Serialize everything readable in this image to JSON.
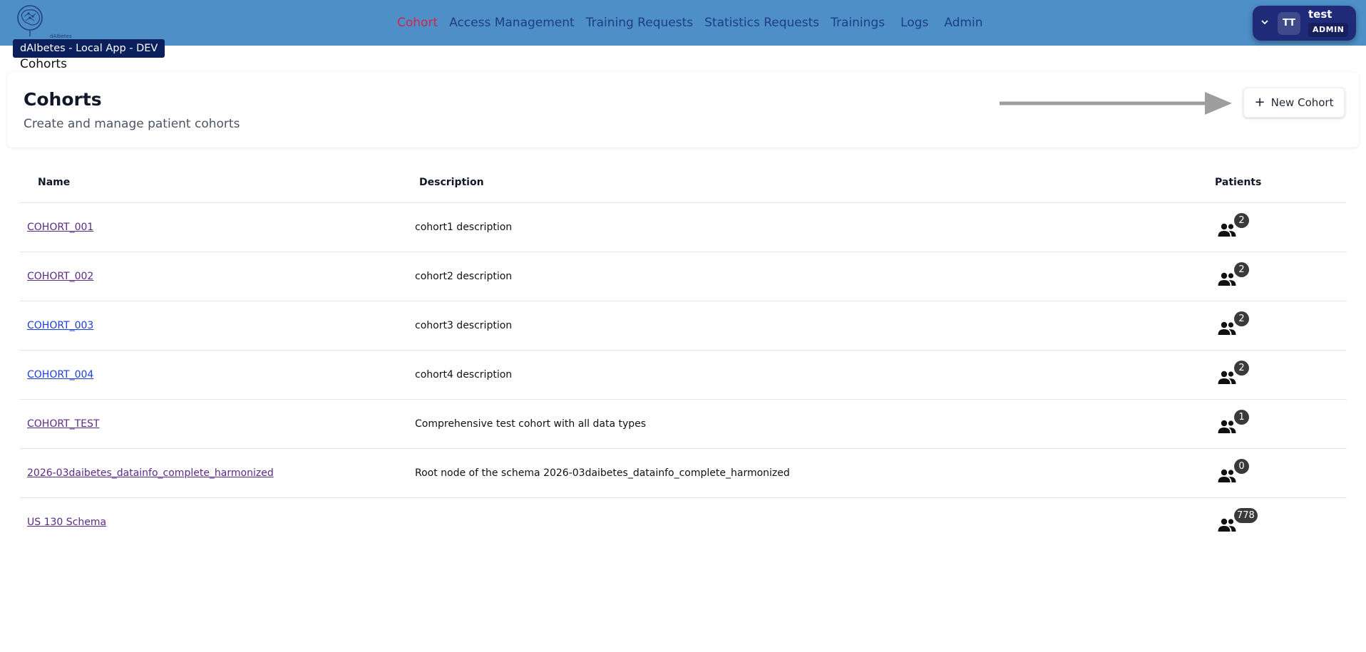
{
  "app": {
    "logo_text": "dAIbetes",
    "env_badge": "dAIbetes - Local App - DEV"
  },
  "nav": {
    "items": [
      {
        "label": "Cohort",
        "active": true
      },
      {
        "label": "Access Management",
        "active": false
      },
      {
        "label": "Training Requests",
        "active": false
      },
      {
        "label": "Statistics Requests",
        "active": false
      },
      {
        "label": "Trainings",
        "active": false
      },
      {
        "label": "Logs",
        "active": false
      },
      {
        "label": "Admin",
        "active": false
      }
    ]
  },
  "user": {
    "initials": "TT",
    "name": "test",
    "role": "ADMIN"
  },
  "breadcrumb": "Cohorts",
  "header": {
    "title": "Cohorts",
    "subtitle": "Create and manage patient cohorts",
    "new_button_icon": "+",
    "new_button_label": "New Cohort"
  },
  "table": {
    "columns": [
      "Name",
      "Description",
      "Patients"
    ],
    "rows": [
      {
        "name": "COHORT_001",
        "description": "cohort1 description",
        "patients": "2",
        "visited": true
      },
      {
        "name": "COHORT_002",
        "description": "cohort2 description",
        "patients": "2",
        "visited": true
      },
      {
        "name": "COHORT_003",
        "description": "cohort3 description",
        "patients": "2",
        "visited": false
      },
      {
        "name": "COHORT_004",
        "description": "cohort4 description",
        "patients": "2",
        "visited": false
      },
      {
        "name": "COHORT_TEST",
        "description": "Comprehensive test cohort with all data types",
        "patients": "1",
        "visited": true
      },
      {
        "name": "2026-03daibetes_datainfo_complete_harmonized",
        "description": "Root node of the schema 2026-03daibetes_datainfo_complete_harmonized",
        "patients": "0",
        "visited": true
      },
      {
        "name": "US 130 Schema",
        "description": "",
        "patients": "778",
        "visited": true
      }
    ]
  },
  "colors": {
    "topbar": "#4e8fc7",
    "nav_link": "#1f3c88",
    "nav_active": "#d0264a",
    "user_menu": "#1f2a78",
    "env_badge": "#0b1f5c",
    "link_visited": "#5b2a86",
    "link": "#1a3ed6"
  },
  "icons": {
    "logo": "brain-logo-icon",
    "user_chevron": "chevron-down-icon",
    "new_button": "plus-icon",
    "patients": "people-icon",
    "hint": "arrow-right-icon"
  }
}
